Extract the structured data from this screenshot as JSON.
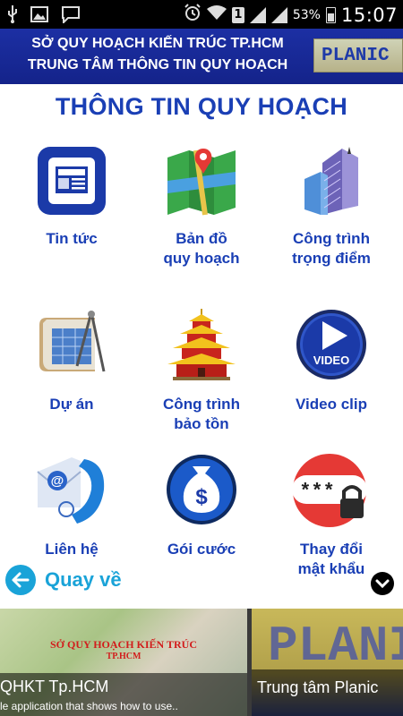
{
  "status_bar": {
    "time": "15:07",
    "battery_percent": "53%",
    "sim_label": "1",
    "left_icons": [
      "usb-icon",
      "image-icon",
      "message-icon"
    ],
    "right_icons": [
      "alarm-icon",
      "wifi-icon",
      "sim-icon",
      "signal-icon",
      "signal-icon",
      "battery-icon"
    ]
  },
  "header": {
    "line1": "SỞ QUY HOẠCH KIẾN TRÚC TP.HCM",
    "line2": "TRUNG TÂM THÔNG TIN QUY HOẠCH",
    "logo_text": "PLANIC"
  },
  "page_title": "THÔNG TIN QUY HOẠCH",
  "menu": [
    {
      "label": "Tin tức",
      "icon": "news-icon"
    },
    {
      "label": "Bản đồ\nquy hoạch",
      "icon": "map-icon"
    },
    {
      "label": "Công trình\ntrọng điểm",
      "icon": "building-icon"
    },
    {
      "label": "Dự án",
      "icon": "blueprint-icon"
    },
    {
      "label": "Công trình\nbảo tồn",
      "icon": "pagoda-icon"
    },
    {
      "label": "Video clip",
      "icon": "video-icon"
    },
    {
      "label": "Liên hệ",
      "icon": "phone-email-icon"
    },
    {
      "label": "Gói cước",
      "icon": "money-bag-icon"
    },
    {
      "label": "Thay đổi\nmật khẩu",
      "icon": "password-icon"
    }
  ],
  "back": {
    "label": "Quay về"
  },
  "video_icon_text": "VIDEO",
  "password_icon_text": "***",
  "thumbnails": [
    {
      "caption": "QHKT Tp.HCM",
      "subtitle": "le application that shows how to use..",
      "overlay_line1": "SỞ QUY HOẠCH KIẾN TRÚC",
      "overlay_line2": "TP.HCM"
    },
    {
      "caption": "Trung tâm Planic",
      "subtitle": "",
      "overlay_text": "PLANI"
    }
  ],
  "colors": {
    "accent": "#1a3fb5",
    "header_bg": "#1c2fa3",
    "back": "#1aa3d8"
  }
}
